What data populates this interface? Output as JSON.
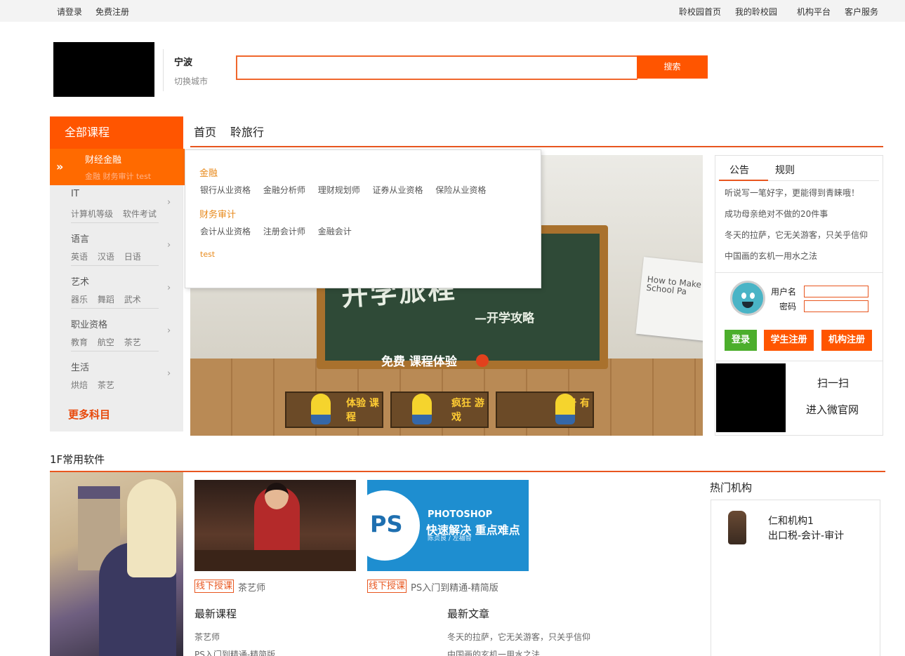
{
  "topbar": {
    "login": "请登录",
    "register": "免费注册",
    "home": "聆校园首页",
    "my": "我的聆校园",
    "org": "机构平台",
    "service": "客户服务"
  },
  "header": {
    "city": "宁波",
    "switch_city": "切换城市",
    "search_placeholder": "",
    "search_button": "搜索"
  },
  "categories": {
    "header": "全部课程",
    "active": {
      "title": "财经金融",
      "subs": "金融  财务审计  test"
    },
    "items": [
      {
        "title": "IT",
        "subs": [
          "计算机等级",
          "软件考试"
        ]
      },
      {
        "title": "语言",
        "subs": [
          "英语",
          "汉语",
          "日语"
        ]
      },
      {
        "title": "艺术",
        "subs": [
          "器乐",
          "舞蹈",
          "武术"
        ]
      },
      {
        "title": "职业资格",
        "subs": [
          "教育",
          "航空",
          "茶艺"
        ]
      },
      {
        "title": "生活",
        "subs": [
          "烘焙",
          "茶艺"
        ]
      }
    ],
    "more": "更多科目"
  },
  "nav": {
    "home": "首页",
    "travel": "聆旅行"
  },
  "dropdown": {
    "groups": [
      {
        "title": "金融",
        "links": [
          "银行从业资格",
          "金融分析师",
          "理财规划师",
          "证券从业资格",
          "保险从业资格"
        ]
      },
      {
        "title": "财务审计",
        "links": [
          "会计从业资格",
          "注册会计师",
          "金融会计"
        ]
      }
    ],
    "test": "test"
  },
  "banner": {
    "board_title": "开学旅程",
    "board_sub": "—开学攻略",
    "free": "免费 课程体验",
    "paper": "How to Make School Pa",
    "tags": [
      "体验 课程",
      "疯狂 游戏",
      "注册 有礼"
    ]
  },
  "notice": {
    "tabs": [
      "公告",
      "规则"
    ],
    "items": [
      "听说写一笔好字，更能得到青睐哦！",
      "成功母亲绝对不做的20件事",
      "冬天的拉萨，它无关游客，只关乎信仰",
      "中国画的玄机一用水之法"
    ]
  },
  "login": {
    "username_label": "用户名",
    "password_label": "密码",
    "login_btn": "登录",
    "student_btn": "学生注册",
    "org_btn": "机构注册"
  },
  "qr": {
    "scan": "扫一扫",
    "enter": "进入微官网"
  },
  "floor": {
    "title": "1F常用软件",
    "courses": [
      {
        "badge": "线下授课",
        "title": "茶艺师"
      },
      {
        "badge": "线下授课",
        "title": "PS入门到精通-精简版"
      }
    ],
    "ps_img": {
      "t1": "PHOTOSHOP",
      "t2": "快速解决  重点难点",
      "t3": "陈贞良 / 左福智"
    },
    "latest_courses": {
      "title": "最新课程",
      "items": [
        "茶艺师",
        "PS入门到精通-精简版"
      ]
    },
    "latest_articles": {
      "title": "最新文章",
      "items": [
        "冬天的拉萨，它无关游客，只关乎信仰",
        "中国画的玄机一用水之法"
      ]
    }
  },
  "hot": {
    "title": "热门机构",
    "name": "仁和机构1",
    "desc": "出口税-会计-审计"
  },
  "colors": {
    "accent": "#ff5500",
    "green": "#4cae2c"
  }
}
